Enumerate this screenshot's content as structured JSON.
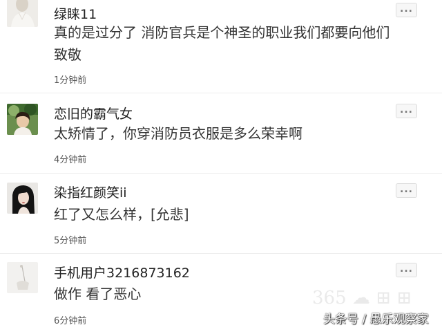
{
  "comments": [
    {
      "username": "绿睐11",
      "content": "真的是过分了 消防官兵是个神圣的职业我们都要向他们致敬",
      "time": "1分钟前",
      "avatar": "avatar-white-clothing-portrait",
      "more_label": "..."
    },
    {
      "username": "恋旧的霸气女",
      "content": "太矫情了，你穿消防员衣服是多么荣幸啊",
      "time": "4分钟前",
      "avatar": "avatar-outdoor-greenery-photo",
      "more_label": "..."
    },
    {
      "username": "染指红颜笑ii",
      "content": "红了又怎么样，[允悲]",
      "time": "5分钟前",
      "avatar": "avatar-dark-hair-woman-photo",
      "more_label": "..."
    },
    {
      "username": "手机用户3216873162",
      "content": "做作 看了恶心",
      "time": "6分钟前",
      "avatar": "avatar-light-sketch",
      "more_label": "..."
    }
  ],
  "watermark": {
    "text": "头条号 / 愚乐观察家"
  }
}
